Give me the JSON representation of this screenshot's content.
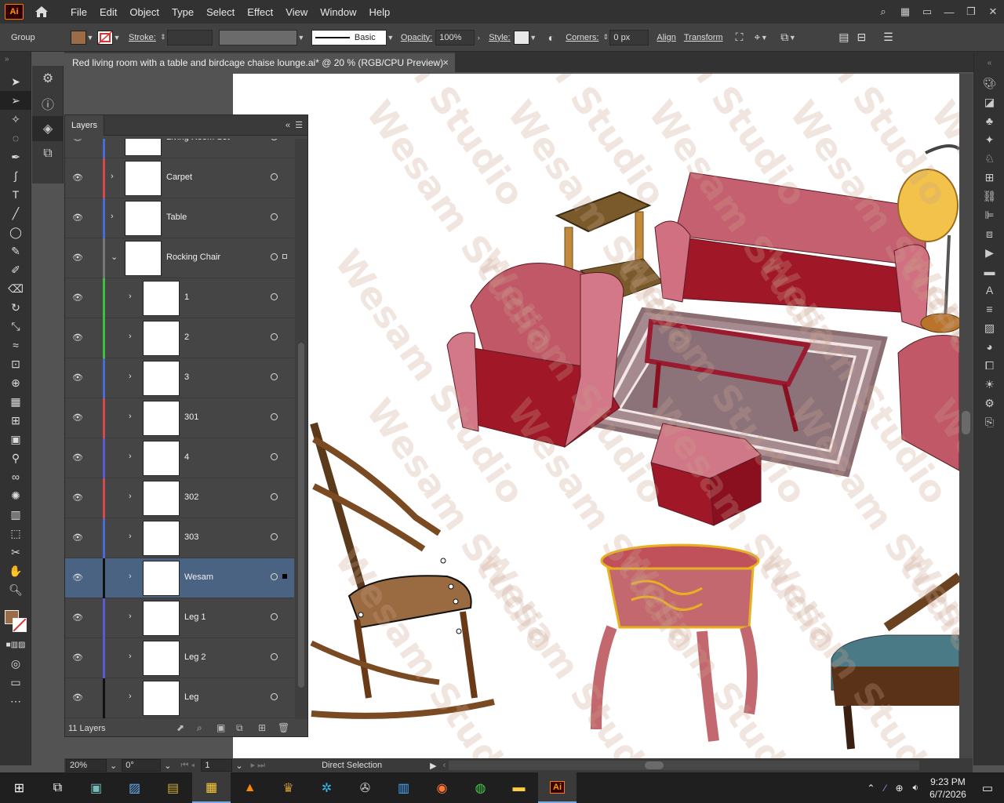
{
  "app": {
    "logo": "Ai",
    "menus": [
      "File",
      "Edit",
      "Object",
      "Type",
      "Select",
      "Effect",
      "View",
      "Window",
      "Help"
    ]
  },
  "control": {
    "group_label": "Group",
    "stroke_label": "Stroke:",
    "brush": "Basic",
    "opacity_label": "Opacity:",
    "opacity_value": "100%",
    "style_label": "Style:",
    "corners_label": "Corners:",
    "corners_value": "0 px",
    "align": "Align",
    "transform": "Transform",
    "fill_color": "#9c6b47"
  },
  "doc_tab": {
    "title": "Red living room with a table and birdcage chaise lounge.ai* @ 20 % (RGB/CPU Preview)",
    "close": "×"
  },
  "layers": {
    "title": "Layers",
    "count": "11 Layers",
    "rows": [
      {
        "name": "Living Room Set",
        "level": 0,
        "stripe": "#4a6bd4"
      },
      {
        "name": "Carpet",
        "level": 0,
        "stripe": "#d44a4a"
      },
      {
        "name": "Table",
        "level": 0,
        "stripe": "#4a6bd4"
      },
      {
        "name": "Rocking Chair",
        "level": 0,
        "stripe": "#777777",
        "expanded": true
      },
      {
        "name": "1",
        "level": 1,
        "stripe": "#3cc23c"
      },
      {
        "name": "2",
        "level": 1,
        "stripe": "#3cc23c"
      },
      {
        "name": "3",
        "level": 1,
        "stripe": "#4a6bd4"
      },
      {
        "name": "301",
        "level": 1,
        "stripe": "#d44a4a"
      },
      {
        "name": "4",
        "level": 1,
        "stripe": "#5a5ad4"
      },
      {
        "name": "302",
        "level": 1,
        "stripe": "#d44a4a"
      },
      {
        "name": "303",
        "level": 1,
        "stripe": "#4a6bd4"
      },
      {
        "name": "Wesam",
        "level": 1,
        "stripe": "#111111",
        "selected": true
      },
      {
        "name": "Leg 1",
        "level": 1,
        "stripe": "#5a5ad4"
      },
      {
        "name": "Leg 2",
        "level": 1,
        "stripe": "#5a5ad4"
      },
      {
        "name": "Leg",
        "level": 1,
        "stripe": "#111111"
      }
    ]
  },
  "status": {
    "zoom": "20%",
    "rotation": "0°",
    "page": "1",
    "tool": "Direct Selection"
  },
  "watermark": {
    "line1": "Wesam",
    "line2": "Studio"
  },
  "taskbar": {
    "time": "9:23 PM",
    "date": "6/7/2026"
  }
}
